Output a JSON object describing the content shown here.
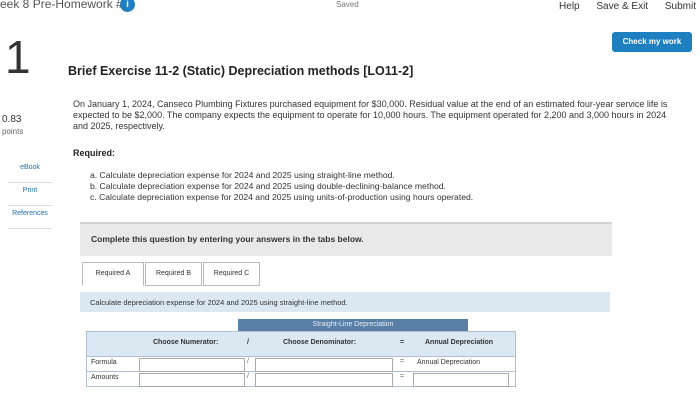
{
  "header": {
    "assignment_title": "eek 8 Pre-Homework #2",
    "info_badge": "i",
    "saved_status": "Saved",
    "links": [
      "Help",
      "Save & Exit",
      "Submit"
    ]
  },
  "question": {
    "number": "1",
    "points_value": "0.83",
    "points_label": "points",
    "side_links": [
      "eBook",
      "Print",
      "References"
    ],
    "check_button": "Check my work",
    "title": "Brief Exercise 11-2 (Static) Depreciation methods [LO11-2]",
    "paragraph": "On January 1, 2024, Canseco Plumbing Fixtures purchased equipment for $30,000. Residual value at the end of an estimated four-year service life is expected to be $2,000. The company expects the equipment to operate for 10,000 hours. The equipment operated for 2,200 and 3,000 hours in 2024 and 2025, respectively.",
    "required_label": "Required:",
    "requirements": [
      "a. Calculate depreciation expense for 2024 and 2025 using straight-line method.",
      "b. Calculate depreciation expense for 2024 and 2025 using double-declining-balance method.",
      "c. Calculate depreciation expense for 2024 and 2025 using units-of-production using hours operated."
    ],
    "complete_instruction": "Complete this question by entering your answers in the tabs below."
  },
  "tabs": [
    "Required A",
    "Required B",
    "Required C"
  ],
  "active_tab_instruction": "Calculate depreciation expense for 2024 and 2025 using straight-line method.",
  "table": {
    "caption": "Straight-Line Depreciation",
    "col_numerator": "Choose Numerator:",
    "div_symbol": "/",
    "col_denominator": "Choose Denominator:",
    "eq_symbol": "=",
    "col_result": "Annual Depreciation",
    "rows": [
      {
        "label": "Formula",
        "result": "Annual Depreciation"
      },
      {
        "label": "Amounts",
        "result": ""
      }
    ]
  },
  "colors": {
    "accent": "#1e7fc1",
    "tab_header": "#5a7fa6",
    "light_blue": "#dbe7f1"
  }
}
